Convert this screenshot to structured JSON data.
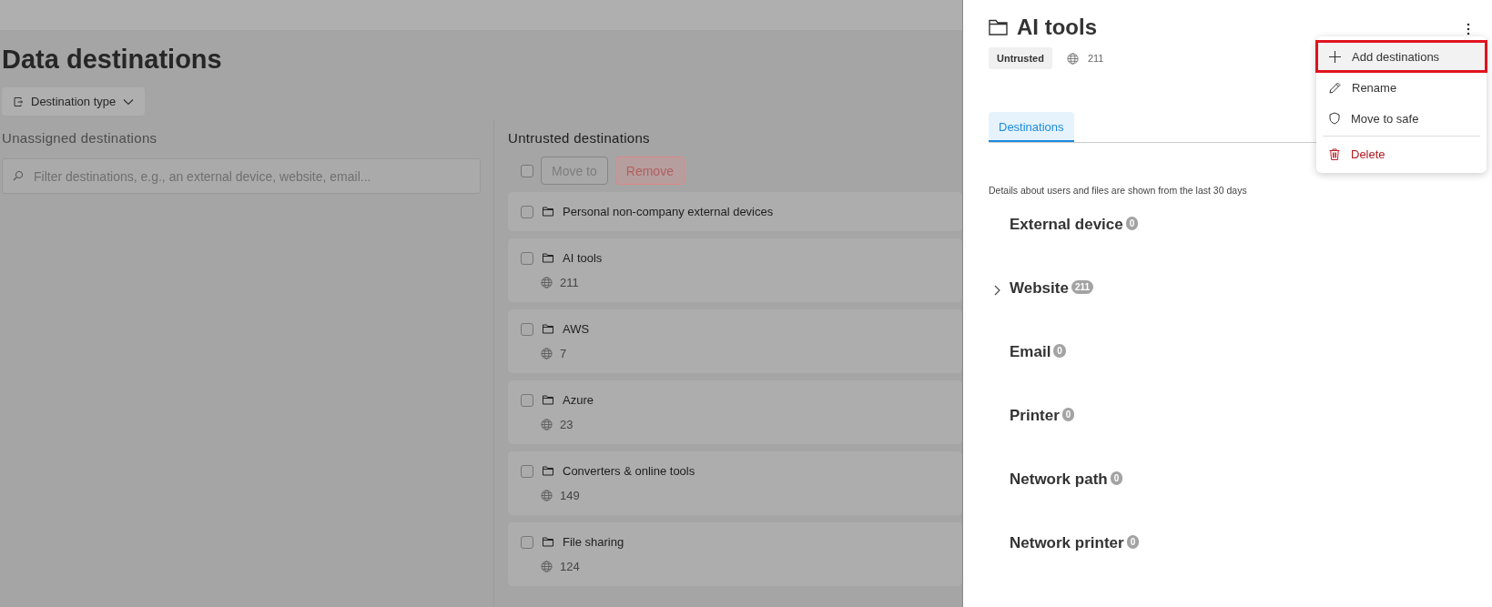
{
  "page": {
    "title": "Data destinations",
    "filter_button": {
      "label": "Destination type"
    }
  },
  "unassigned": {
    "heading": "Unassigned destinations",
    "search": {
      "placeholder": "Filter destinations, e.g., an external device, website, email..."
    }
  },
  "untrusted": {
    "heading": "Untrusted destinations",
    "select_all": {
      "checked": false
    },
    "actions": [
      {
        "label": "Move to",
        "kind": "neutral",
        "disabled": true
      },
      {
        "label": "Remove",
        "kind": "danger",
        "disabled": true
      }
    ],
    "groups": [
      {
        "name": "Personal non-company external devices",
        "checked": false
      },
      {
        "name": "AI tools",
        "count": "211",
        "checked": false
      },
      {
        "name": "AWS",
        "count": "7",
        "checked": false
      },
      {
        "name": "Azure",
        "count": "23",
        "checked": false
      },
      {
        "name": "Converters & online tools",
        "count": "149",
        "checked": false
      },
      {
        "name": "File sharing",
        "count": "124",
        "checked": false
      }
    ]
  },
  "panel": {
    "title": "AI tools",
    "badge": "Untrusted",
    "count": "211",
    "tabs": [
      {
        "label": "Destinations",
        "selected": true
      }
    ],
    "note": "Details about users and files are shown from the last 30 days",
    "categories": [
      {
        "name": "External device",
        "count": "0",
        "expandable": false
      },
      {
        "name": "Website",
        "count": "211",
        "expandable": true
      },
      {
        "name": "Email",
        "count": "0",
        "expandable": false
      },
      {
        "name": "Printer",
        "count": "0",
        "expandable": false
      },
      {
        "name": "Network path",
        "count": "0",
        "expandable": false
      },
      {
        "name": "Network printer",
        "count": "0",
        "expandable": false
      }
    ],
    "menu": [
      {
        "label": "Add destinations",
        "kind": "add",
        "highlighted": true
      },
      {
        "label": "Rename",
        "kind": "rename",
        "highlighted": false
      },
      {
        "label": "Move to safe",
        "kind": "safe",
        "highlighted": false
      },
      {
        "label": "Delete",
        "kind": "delete",
        "highlighted": false
      }
    ]
  }
}
